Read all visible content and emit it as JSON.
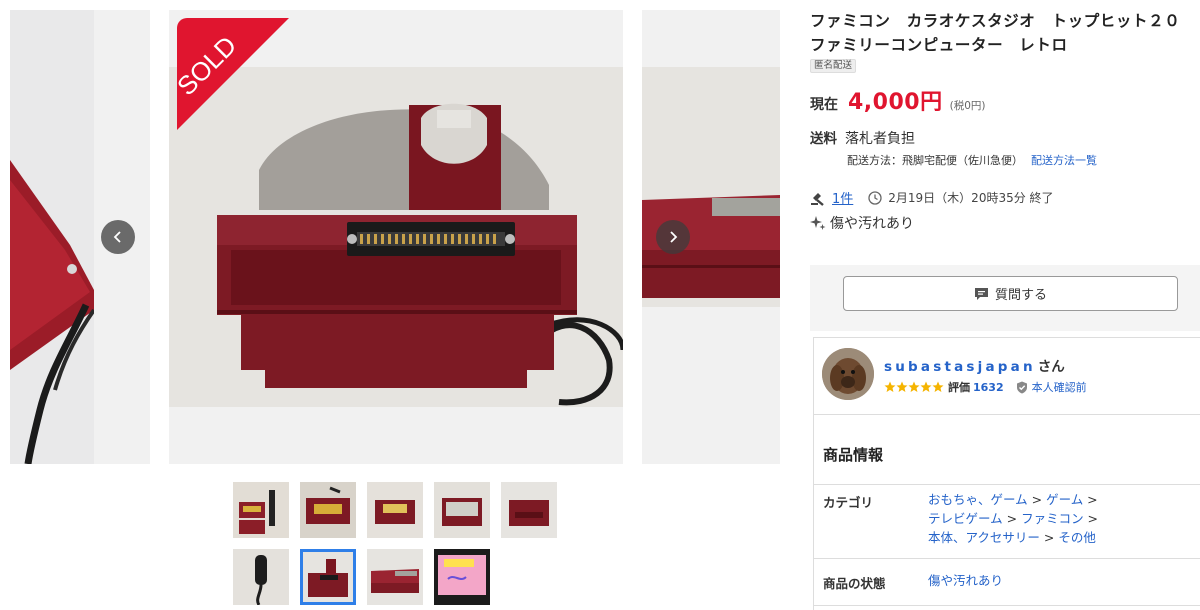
{
  "product": {
    "title": "ファミコン　カラオケスタジオ　トップヒット２０　ファミリーコンピューター　レトロ",
    "anonymous_tag": "匿名配送"
  },
  "gallery": {
    "sold_label": "SOLD",
    "thumbnail_count": 9,
    "active_thumbnail": 7
  },
  "price": {
    "label": "現在",
    "value": "4,000円",
    "tax": "(税0円)"
  },
  "shipping": {
    "label": "送料",
    "value": "落札者負担",
    "method": "配送方法：飛脚宅配便（佐川急便）",
    "method_link": "配送方法一覧"
  },
  "auction": {
    "bids": "1件",
    "end_time": "2月19日（木）20時35分 終了",
    "condition": "傷や汚れあり"
  },
  "question_button": {
    "label": "質問する"
  },
  "seller": {
    "name": "subastasjapan",
    "suffix": "さん",
    "rating_label": "評価",
    "rating_value": "1632",
    "verification": "本人確認前",
    "stars": 5
  },
  "product_info": {
    "title": "商品情報",
    "category_label": "カテゴリ",
    "category_path": [
      "おもちゃ、ゲーム",
      "ゲーム",
      "テレビゲーム",
      "ファミコン",
      "本体、アクセサリー",
      "その他"
    ],
    "condition_label": "商品の状態",
    "condition_value": "傷や汚れあり"
  },
  "colors": {
    "accent_red": "#e0152f",
    "link_blue": "#2563c9",
    "star_yellow": "#f5b400"
  }
}
